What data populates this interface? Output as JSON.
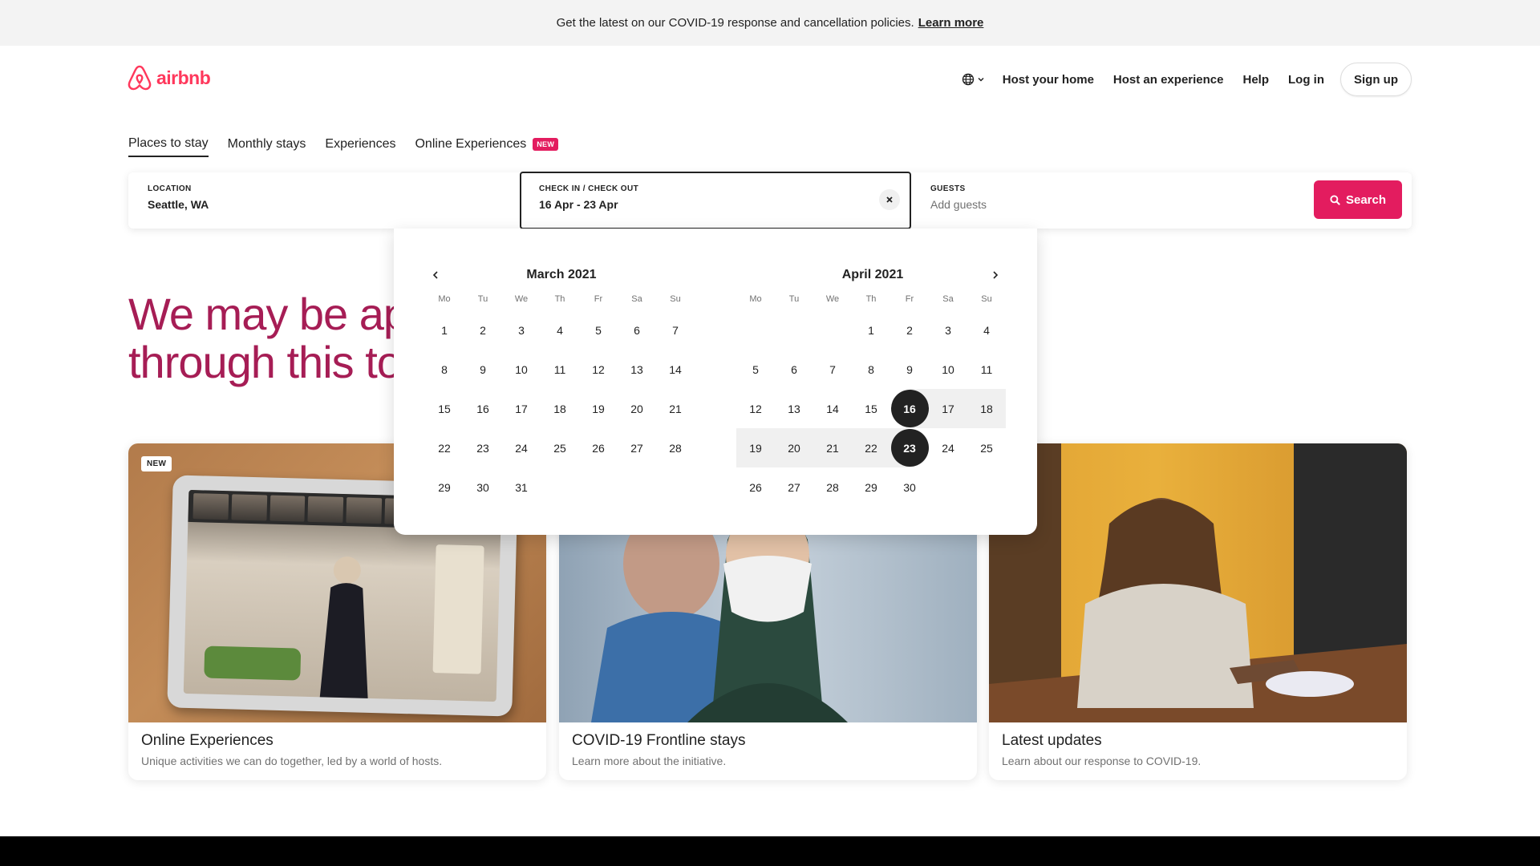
{
  "banner": {
    "text": "Get the latest on our COVID-19 response and cancellation policies.",
    "link": "Learn more"
  },
  "brand": {
    "name": "airbnb",
    "color": "#ff385c"
  },
  "nav": {
    "language_icon": "globe-icon",
    "items": [
      "Host your home",
      "Host an experience",
      "Help",
      "Log in"
    ],
    "signup": "Sign up"
  },
  "tabs": [
    {
      "label": "Places to stay",
      "active": true
    },
    {
      "label": "Monthly stays"
    },
    {
      "label": "Experiences"
    },
    {
      "label": "Online Experiences",
      "badge": "NEW"
    }
  ],
  "search": {
    "location": {
      "label": "LOCATION",
      "value": "Seattle, WA"
    },
    "dates": {
      "label": "CHECK IN / CHECK OUT",
      "value": "16 Apr - 23 Apr"
    },
    "guests": {
      "label": "GUESTS",
      "placeholder": "Add guests"
    },
    "button": "Search"
  },
  "hero": {
    "line1": "We may be apa",
    "line2": "through this tog"
  },
  "calendar": {
    "weekdays": [
      "Mo",
      "Tu",
      "We",
      "Th",
      "Fr",
      "Sa",
      "Su"
    ],
    "months": [
      {
        "title": "March 2021",
        "offset": 0,
        "days": 31
      },
      {
        "title": "April 2021",
        "offset": 3,
        "days": 30
      }
    ],
    "selected_start": 16,
    "selected_end": 23
  },
  "cards": [
    {
      "title": "Online Experiences",
      "subtitle": "Unique activities we can do together, led by a world of hosts.",
      "tag": "NEW"
    },
    {
      "title": "COVID-19 Frontline stays",
      "subtitle": "Learn more about the initiative."
    },
    {
      "title": "Latest updates",
      "subtitle": "Learn about our response to COVID-19."
    }
  ]
}
